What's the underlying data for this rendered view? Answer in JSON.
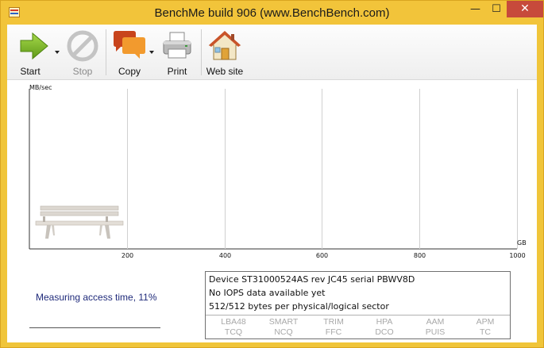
{
  "window": {
    "title": "BenchMe build 906 (www.BenchBench.com)",
    "controls": {
      "minimize": "—",
      "maximize": "☐",
      "close": "✕"
    }
  },
  "toolbar": {
    "start_label": "Start",
    "stop_label": "Stop",
    "copy_label": "Copy",
    "print_label": "Print",
    "website_label": "Web site"
  },
  "chart_data": {
    "type": "line",
    "ylabel": "MB/sec",
    "xlabel": "GB",
    "x_ticks": [
      "200",
      "400",
      "600",
      "800",
      "1000"
    ],
    "xlim": [
      0,
      1000
    ],
    "grid": true,
    "series": []
  },
  "status": {
    "text": "Measuring access time, 11%"
  },
  "device_info": {
    "line1": "Device ST31000524AS rev JC45 serial PBWV8D",
    "line2": "No IOPS data available yet",
    "line3": "512/512 bytes per physical/logical sector",
    "features": [
      {
        "top": "LBA48",
        "bottom": "TCQ"
      },
      {
        "top": "SMART",
        "bottom": "NCQ"
      },
      {
        "top": "TRIM",
        "bottom": "FFC"
      },
      {
        "top": "HPA",
        "bottom": "DCO"
      },
      {
        "top": "AAM",
        "bottom": "PUIS"
      },
      {
        "top": "APM",
        "bottom": "TC"
      }
    ]
  },
  "colors": {
    "frame": "#f2c43a",
    "close_button": "#c74a3b",
    "status_text": "#1f2a7a",
    "feature_disabled": "#a8a8a8",
    "start_arrow": "#7fb82a",
    "copy_bubble_back": "#c8441c",
    "copy_bubble_front": "#f29a2e"
  },
  "icons": {
    "start": "green-arrow-icon",
    "stop": "no-entry-icon",
    "copy": "speech-bubbles-icon",
    "print": "printer-icon",
    "website": "house-icon",
    "bench": "bench-image"
  }
}
